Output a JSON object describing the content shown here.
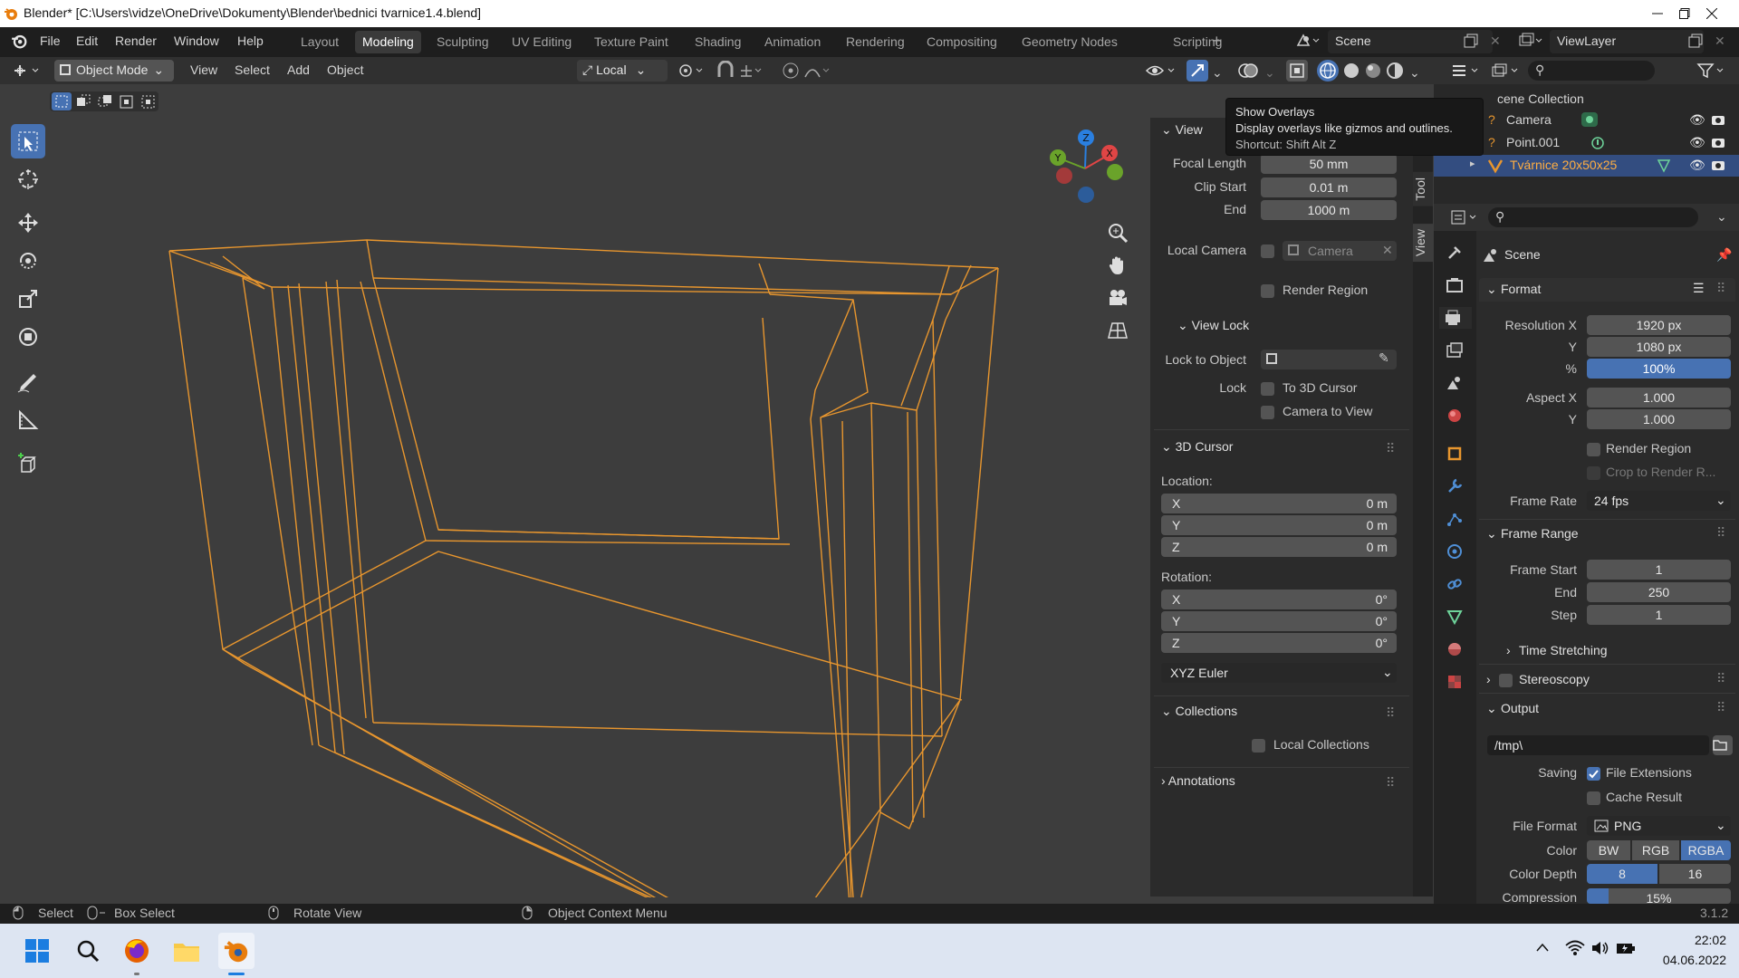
{
  "window": {
    "title": "Blender* [C:\\Users\\vidze\\OneDrive\\Dokumenty\\Blender\\bednici tvarnice1.4.blend]"
  },
  "menu": {
    "file": "File",
    "edit": "Edit",
    "render": "Render",
    "window": "Window",
    "help": "Help"
  },
  "workspaces": [
    "Layout",
    "Modeling",
    "Sculpting",
    "UV Editing",
    "Texture Paint",
    "Shading",
    "Animation",
    "Rendering",
    "Compositing",
    "Geometry Nodes",
    "Scripting"
  ],
  "active_workspace": "Modeling",
  "scene_name": "Scene",
  "view_layer": "ViewLayer",
  "header": {
    "mode": "Object Mode",
    "view": "View",
    "select": "Select",
    "add": "Add",
    "object": "Object",
    "transform_orientation": "Local"
  },
  "tooltip": {
    "title": "Show Overlays",
    "description": "Display overlays like gizmos and outlines.",
    "shortcut": "Shortcut: Shift Alt Z"
  },
  "npanel": {
    "tabs": [
      "Tool",
      "View"
    ],
    "view_title": "View",
    "focal_length_label": "Focal Length",
    "focal_length": "50 mm",
    "clip_start_label": "Clip Start",
    "clip_start": "0.01 m",
    "clip_end_label": "End",
    "clip_end": "1000 m",
    "local_camera_label": "Local Camera",
    "local_camera": "Camera",
    "render_region": "Render Region",
    "view_lock_title": "View Lock",
    "lock_to_object_label": "Lock to Object",
    "lock_label": "Lock",
    "to_3d_cursor": "To 3D Cursor",
    "camera_to_view": "Camera to View",
    "cursor_title": "3D Cursor",
    "location_label": "Location:",
    "loc_x": "0 m",
    "loc_y": "0 m",
    "loc_z": "0 m",
    "rotation_label": "Rotation:",
    "rot_x": "0°",
    "rot_y": "0°",
    "rot_z": "0°",
    "rotation_mode": "XYZ Euler",
    "axis_x": "X",
    "axis_y": "Y",
    "axis_z": "Z",
    "collections_title": "Collections",
    "local_collections": "Local Collections",
    "annotations_title": "Annotations"
  },
  "outliner": {
    "root": "cene Collection",
    "items": [
      "Camera",
      "Point.001",
      "Tvárnice 20x50x25"
    ]
  },
  "properties": {
    "scene_label": "Scene",
    "format_title": "Format",
    "res_x_label": "Resolution X",
    "res_x": "1920 px",
    "res_y_label": "Y",
    "res_y": "1080 px",
    "res_pct_label": "%",
    "res_pct": "100%",
    "aspect_x_label": "Aspect X",
    "aspect_x": "1.000",
    "aspect_y_label": "Y",
    "aspect_y": "1.000",
    "render_region": "Render Region",
    "crop_region": "Crop to Render R...",
    "frame_rate_label": "Frame Rate",
    "frame_rate": "24 fps",
    "frame_range_title": "Frame Range",
    "frame_start_label": "Frame Start",
    "frame_start": "1",
    "frame_end_label": "End",
    "frame_end": "250",
    "frame_step_label": "Step",
    "frame_step": "1",
    "time_stretching": "Time Stretching",
    "stereoscopy": "Stereoscopy",
    "output_title": "Output",
    "output_path": "/tmp\\",
    "saving_label": "Saving",
    "file_extensions": "File Extensions",
    "cache_result": "Cache Result",
    "file_format_label": "File Format",
    "file_format": "PNG",
    "color_label": "Color",
    "color_bw": "BW",
    "color_rgb": "RGB",
    "color_rgba": "RGBA",
    "color_depth_label": "Color Depth",
    "depth_8": "8",
    "depth_16": "16",
    "compression_label": "Compression",
    "compression": "15%"
  },
  "statusbar": {
    "select": "Select",
    "box_select": "Box Select",
    "rotate_view": "Rotate View",
    "context_menu": "Object Context Menu",
    "version": "3.1.2"
  },
  "taskbar": {
    "time": "22:02",
    "date": "04.06.2022"
  },
  "colors": {
    "accent": "#4772b3",
    "wireframe": "#e8962e",
    "viewport_bg": "#3d3d3d",
    "panel_bg": "#2b2b2b"
  }
}
